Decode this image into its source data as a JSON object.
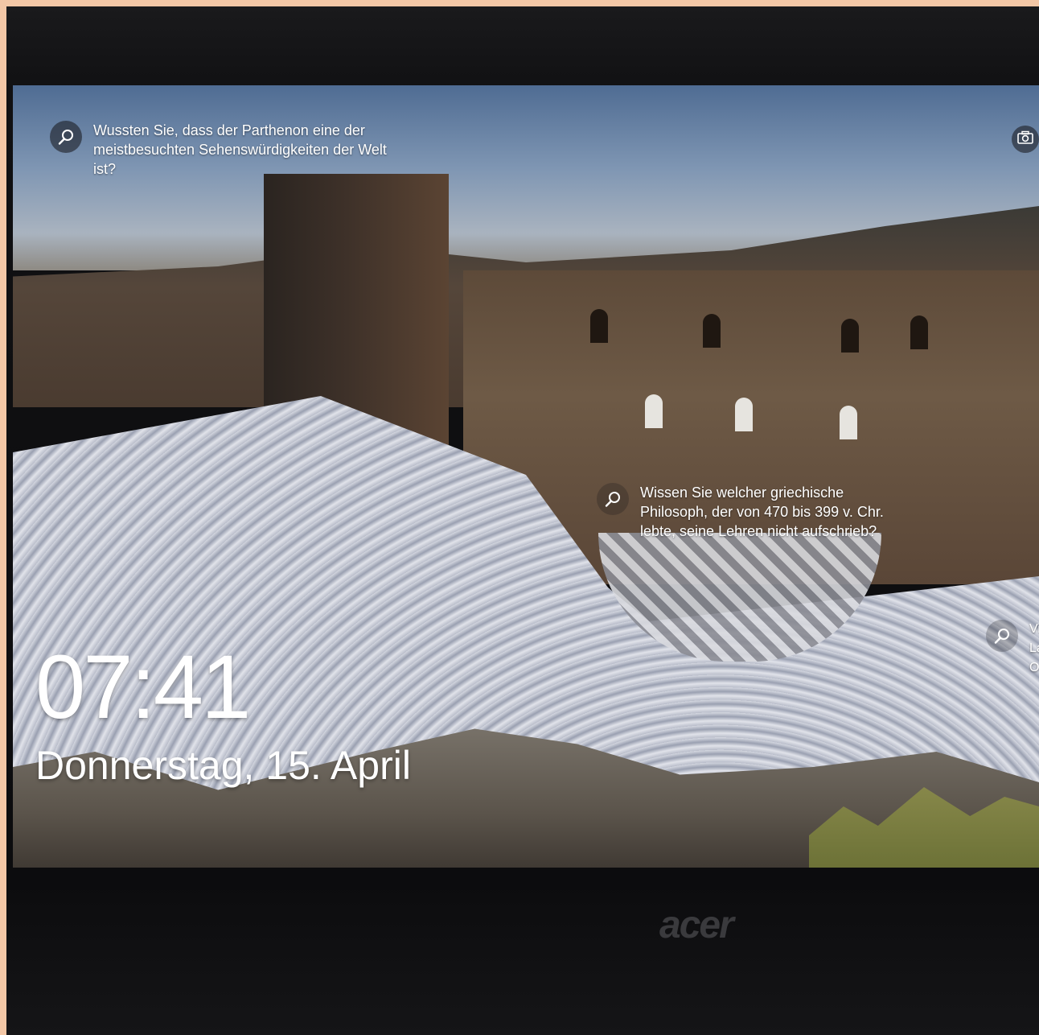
{
  "lockscreen": {
    "hints": [
      {
        "text": "Wussten Sie, dass der Parthenon eine der meistbesuchten Sehenswürdigkeiten der Welt ist?",
        "icon": "search-icon"
      },
      {
        "text": "Wissen Sie welcher griechische Philosoph, der von 470 bis 399 v. Chr. lebte, seine Lehren nicht aufschrieb?",
        "icon": "search-icon"
      },
      {
        "text": "Vi\nLa\nO",
        "icon": "search-icon"
      }
    ],
    "camera_icon": "camera-icon",
    "time": "07:41",
    "date": "Donnerstag, 15. April"
  },
  "device": {
    "brand": "acer"
  }
}
